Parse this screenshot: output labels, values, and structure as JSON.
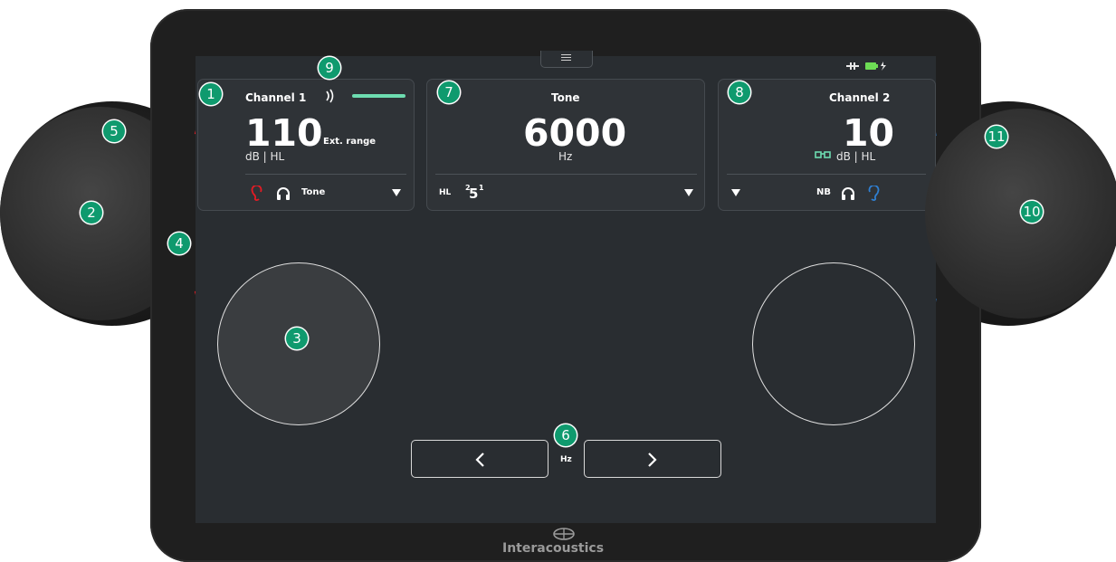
{
  "top_bar": {
    "menu_icon": "hamburger-icon",
    "status_icons": [
      "plug-icon",
      "battery-charging-icon"
    ]
  },
  "channel1": {
    "title": "Channel 1",
    "level": "110",
    "level_units": "dB | HL",
    "ext_range": "Ext. range",
    "stimulus": "Tone",
    "indicator_color": "#e51b24"
  },
  "center": {
    "title": "Tone",
    "frequency": "6000",
    "frequency_units": "Hz",
    "mode_label": "HL",
    "step_sup_left": "2",
    "step_main": "5",
    "step_sup_right": "1"
  },
  "channel2": {
    "title": "Channel 2",
    "level": "10",
    "level_units": "dB | HL",
    "stimulus": "NB",
    "indicator_color": "#2f7fd1"
  },
  "nav": {
    "hz_label": "Hz",
    "prev_icon": "chevron-left-icon",
    "next_icon": "chevron-right-icon"
  },
  "brand": {
    "name": "Interacoustics"
  },
  "callouts": [
    "1",
    "2",
    "3",
    "4",
    "5",
    "6",
    "7",
    "8",
    "9",
    "10",
    "11"
  ],
  "colors": {
    "accent": "#0f9a6e",
    "vu_bar": "#6ddcb0",
    "left_ear": "#e51b24",
    "right_ear": "#2f7fd1"
  }
}
